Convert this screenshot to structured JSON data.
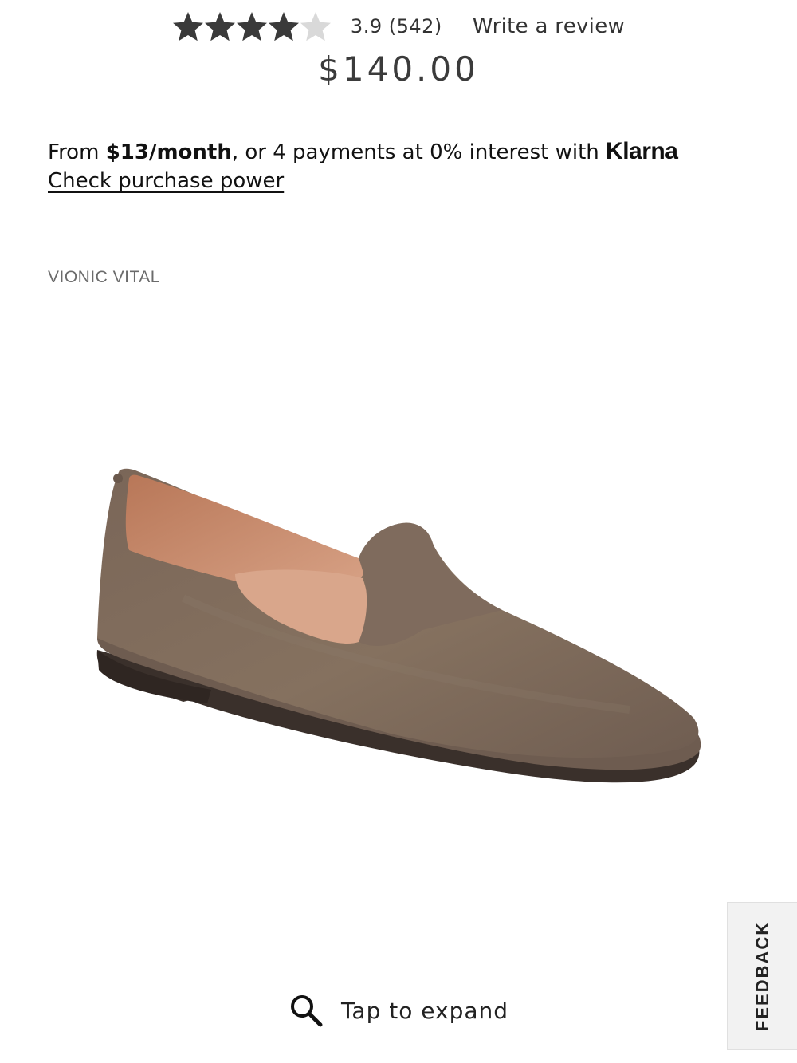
{
  "review": {
    "rating_value": 3.9,
    "stars_total": 5,
    "stars_filled": 4,
    "rating_text": "3.9 (542)",
    "write_review_label": "Write a review"
  },
  "price": {
    "amount": "$140.00"
  },
  "klarna": {
    "prefix": "From ",
    "monthly": "$13/month",
    "middle": ", or 4 payments at 0% interest with ",
    "brand": "Klarna",
    "link_label": "Check purchase power"
  },
  "product": {
    "brand_name": "VIONIC VITAL",
    "image_icon": "loafer-shoe-image"
  },
  "expand": {
    "icon": "search-icon",
    "label": "Tap to expand"
  },
  "feedback": {
    "label": "FEEDBACK"
  },
  "colors": {
    "star_filled": "#3a3a3a",
    "star_empty": "#d9d9d9",
    "shoe_suede": "#7d6a5c",
    "shoe_lining": "#c98c6b",
    "sole": "#3a302b"
  }
}
